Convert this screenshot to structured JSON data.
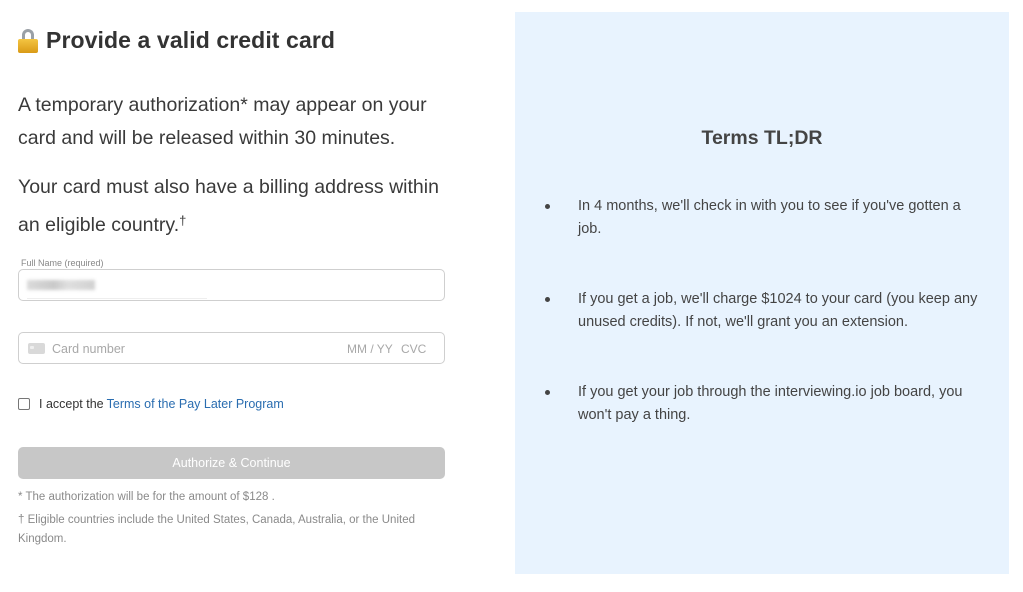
{
  "header": {
    "icon": "lock-icon",
    "title": "Provide a valid credit card"
  },
  "intro": {
    "authorization_text": "A temporary authorization* may appear on your card and will be released within 30 minutes.",
    "billing_text": "Your card must also have a billing address within an eligible country.",
    "billing_mark": "†"
  },
  "form": {
    "full_name_label": "Full Name (required)",
    "card_icon": "credit-card-icon",
    "card_number_placeholder": "Card number",
    "expiry_placeholder": "MM / YY",
    "cvc_placeholder": "CVC",
    "accept_prefix": "I accept the",
    "accept_link": "Terms of the Pay Later Program",
    "accept_checked": false,
    "submit_label": "Authorize & Continue"
  },
  "footnotes": {
    "amount_note": "* The authorization will be for the amount of $128 .",
    "countries_note": "† Eligible countries include the United States, Canada, Australia, or the United Kingdom."
  },
  "terms": {
    "title": "Terms TL;DR",
    "items": [
      "In 4 months, we'll check in with you to see if you've gotten a job.",
      "If you get a job, we'll charge $1024 to your card (you keep any unused credits). If not, we'll grant you an extension.",
      "If you get your job through the interviewing.io job board, you won't pay a thing."
    ]
  },
  "colors": {
    "terms_panel_bg": "#e8f3fe",
    "link": "#2a6db0",
    "button_disabled": "#c7c7c7"
  }
}
